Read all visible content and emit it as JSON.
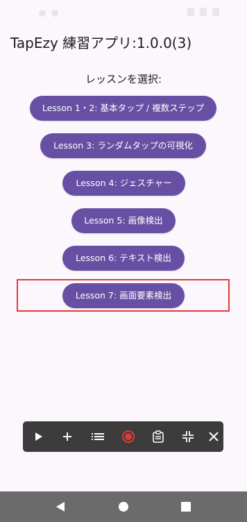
{
  "app": {
    "title": "TapEzy 練習アプリ:1.0.0(3)"
  },
  "main": {
    "prompt": "レッスンを選択:",
    "lessons": [
      {
        "label": "Lesson 1・2: 基本タップ / 複数ステップ"
      },
      {
        "label": "Lesson 3: ランダムタップの可視化"
      },
      {
        "label": "Lesson 4: ジェスチャー"
      },
      {
        "label": "Lesson 5: 画像検出"
      },
      {
        "label": "Lesson 6: テキスト検出"
      },
      {
        "label": "Lesson 7: 画面要素検出"
      }
    ],
    "highlighted_lesson_index": 6
  },
  "toolbar": {
    "items": [
      {
        "icon": "play-icon"
      },
      {
        "icon": "plus-icon"
      },
      {
        "icon": "list-icon"
      },
      {
        "icon": "record-icon"
      },
      {
        "icon": "clipboard-icon"
      },
      {
        "icon": "collapse-icon"
      },
      {
        "icon": "close-icon"
      }
    ],
    "background": "#3c3c3c",
    "record_color": "#e53935"
  },
  "navigation": {
    "items": [
      {
        "icon": "back-icon"
      },
      {
        "icon": "home-icon"
      },
      {
        "icon": "recents-icon"
      }
    ]
  },
  "colors": {
    "background": "#fcf7fd",
    "button": "#6750a4",
    "highlight": "#e53935",
    "nav_bar": "#6b6b6b"
  }
}
